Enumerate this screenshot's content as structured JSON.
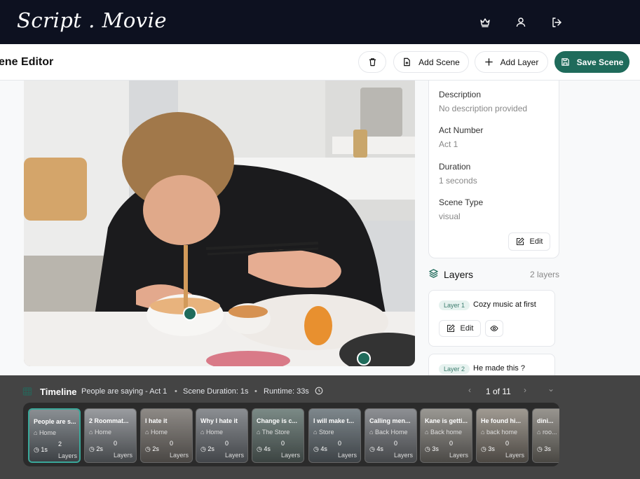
{
  "app": {
    "logo": "Script . Movie"
  },
  "nav": {
    "crown_icon": "crown-icon",
    "user_icon": "user-icon",
    "logout_icon": "logout-icon"
  },
  "editor": {
    "title": "ene Editor",
    "delete_icon": "trash-icon",
    "add_scene": "Add Scene",
    "add_layer": "Add Layer",
    "save_scene": "Save Scene"
  },
  "details": {
    "description_label": "Description",
    "description_value": "No description provided",
    "act_label": "Act Number",
    "act_value": "Act 1",
    "duration_label": "Duration",
    "duration_value": "1 seconds",
    "type_label": "Scene Type",
    "type_value": "visual",
    "edit_label": "Edit"
  },
  "layers": {
    "title": "Layers",
    "count": "2 layers",
    "items": [
      {
        "badge": "Layer 1",
        "name": "Cozy music at first",
        "edit_label": "Edit"
      },
      {
        "badge": "Layer 2",
        "name": "He made this ?"
      }
    ]
  },
  "timeline": {
    "title": "Timeline",
    "scene_ref": "People are saying - Act 1",
    "sep": "•",
    "scene_duration": "Scene Duration: 1s",
    "runtime": "Runtime: 33s",
    "prev": "‹",
    "page": "1 of 11",
    "next": "›",
    "collapse": "⌄",
    "layers_label": "Layers",
    "cards": [
      {
        "name": "People are s...",
        "location": "Home",
        "duration": "1s",
        "layers": "2"
      },
      {
        "name": "2 Roommat...",
        "location": "Home",
        "duration": "2s",
        "layers": "0"
      },
      {
        "name": "I hate it",
        "location": "Home",
        "duration": "2s",
        "layers": "0"
      },
      {
        "name": "Why I hate it",
        "location": "Home",
        "duration": "2s",
        "layers": "0"
      },
      {
        "name": "Change is c...",
        "location": "The Store",
        "duration": "4s",
        "layers": "0"
      },
      {
        "name": "I will make t...",
        "location": "Store",
        "duration": "4s",
        "layers": "0"
      },
      {
        "name": "Calling men...",
        "location": "Back Home",
        "duration": "4s",
        "layers": "0"
      },
      {
        "name": "Kane is getti...",
        "location": "Back home",
        "duration": "3s",
        "layers": "0"
      },
      {
        "name": "He found hi...",
        "location": "back home",
        "duration": "3s",
        "layers": "0"
      },
      {
        "name": "dini...",
        "location": "roo...",
        "duration": "3s",
        "layers": ""
      }
    ]
  },
  "colors": {
    "accent": "#1f6b5b",
    "nav_bg": "#0d1120",
    "timeline_bg": "#444444"
  }
}
